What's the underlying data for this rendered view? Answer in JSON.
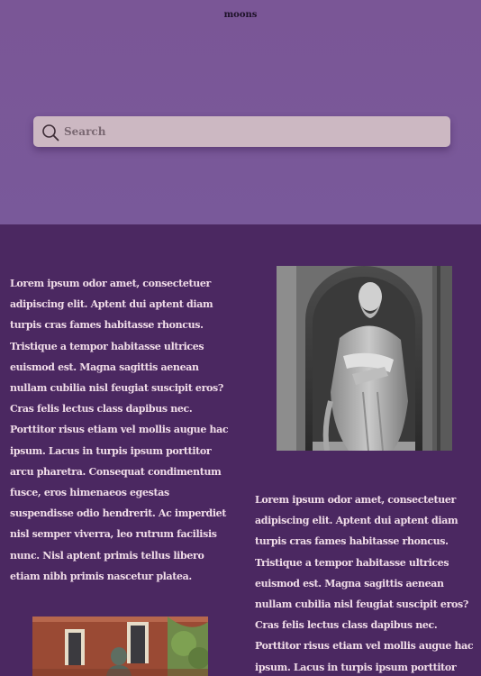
{
  "brand": {
    "title": "moons"
  },
  "search": {
    "placeholder": "Search",
    "value": ""
  },
  "articles": [
    {
      "text": "Lorem ipsum odor amet, consectetuer adipiscing elit. Aptent dui aptent diam turpis cras fames habitasse rhoncus. Tristique a tempor habitasse ultrices euismod est. Magna sagittis aenean nullam cubilia nisl feugiat suscipit eros? Cras felis lectus class dapibus nec. Porttitor risus etiam vel mollis augue hac ipsum. Lacus in turpis ipsum porttitor arcu pharetra. Consequat condimentum fusce, eros himenaeos egestas suspendisse odio hendrerit. Ac imperdiet nisl semper viverra, leo rutrum facilisis nunc. Nisl aptent primis tellus libero etiam nibh primis nascetur platea."
    },
    {
      "text": "Lorem ipsum odor amet, consectetuer adipiscing elit. Aptent dui aptent diam turpis cras fames habitasse rhoncus. Tristique a tempor habitasse ultrices euismod est. Magna sagittis aenean nullam cubilia nisl feugiat suscipit eros? Cras felis lectus class dapibus nec. Porttitor risus etiam vel mollis augue hac ipsum. Lacus in turpis ipsum porttitor arcu pharetra. Consequat"
    }
  ],
  "images": {
    "statue": {
      "alt": "statue-photo"
    },
    "building": {
      "alt": "building-statue-photo"
    }
  },
  "icons": {
    "search": "search-icon"
  },
  "colors": {
    "hero_bg": "#7a5696",
    "content_bg": "#4b2861",
    "search_bg": "#ccb8c2",
    "text": "#f0dce8"
  }
}
